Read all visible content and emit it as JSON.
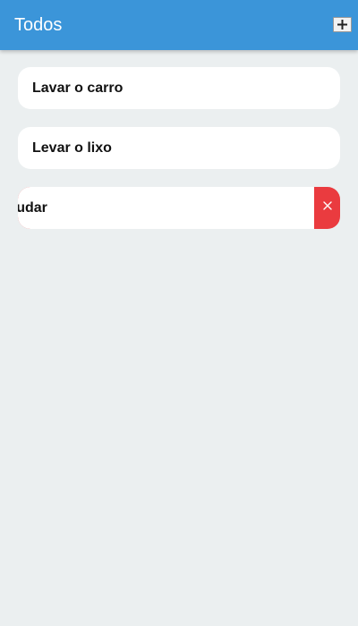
{
  "app_bar": {
    "title": "Todos",
    "add_icon": "plus-icon",
    "color": "#3b95d9"
  },
  "todos": [
    {
      "label": "Lavar o carro"
    },
    {
      "label": "Levar o lixo"
    },
    {
      "label": "Estudar",
      "visible_text": "studar",
      "swiped_open": true,
      "action_icon": "close-icon",
      "action_color": "#ea3b3f"
    }
  ]
}
